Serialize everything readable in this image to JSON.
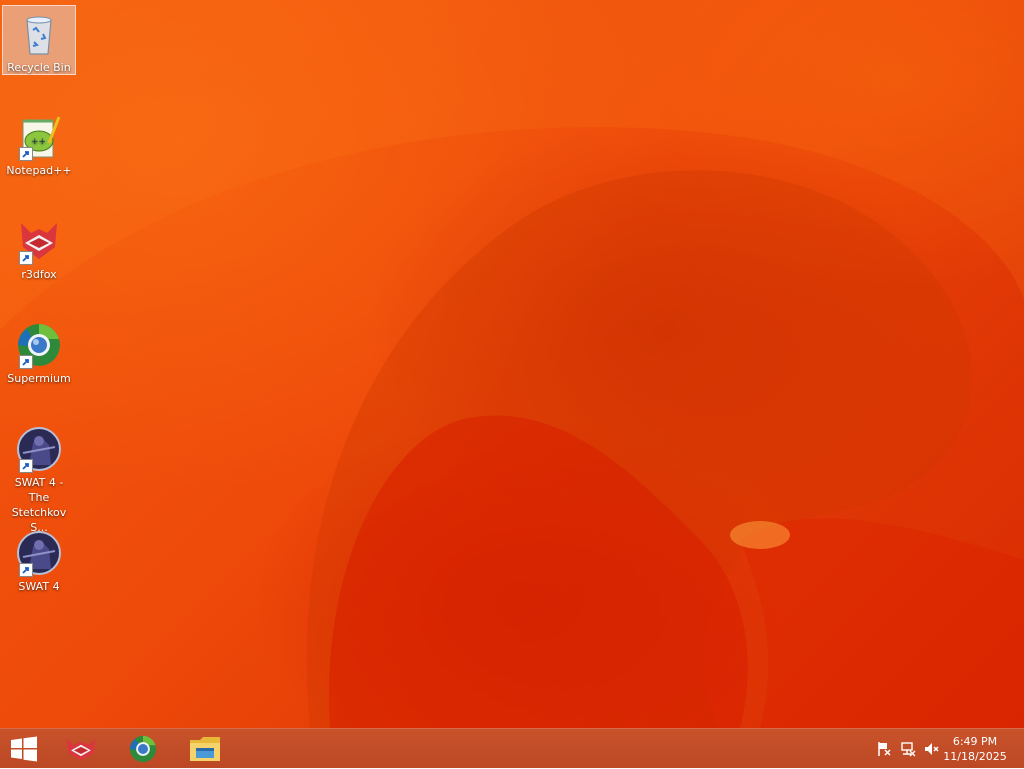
{
  "desktop": {
    "icons": [
      {
        "name": "recycle-bin-icon",
        "label": "Recycle Bin",
        "selected": true
      },
      {
        "name": "notepadpp-icon",
        "label": "Notepad++"
      },
      {
        "name": "r3dfox-icon",
        "label": "r3dfox"
      },
      {
        "name": "supermium-icon",
        "label": "Supermium"
      },
      {
        "name": "swat4-stetchkov-icon",
        "label": "SWAT 4 - The Stetchkov S..."
      },
      {
        "name": "swat4-icon",
        "label": "SWAT 4"
      }
    ]
  },
  "taskbar": {
    "start_icon": "windows-logo-icon",
    "pinned": [
      "r3dfox-icon",
      "supermium-icon",
      "file-explorer-icon"
    ],
    "tray_icons": [
      "action-center-flag-icon",
      "network-icon",
      "volume-muted-icon"
    ],
    "clock": {
      "time": "6:49 PM",
      "date": "11/18/2025"
    }
  },
  "colors": {
    "wallpaper_primary": "#ee4a0a",
    "wallpaper_dark": "#d82a02",
    "taskbar": "#c24d28"
  }
}
